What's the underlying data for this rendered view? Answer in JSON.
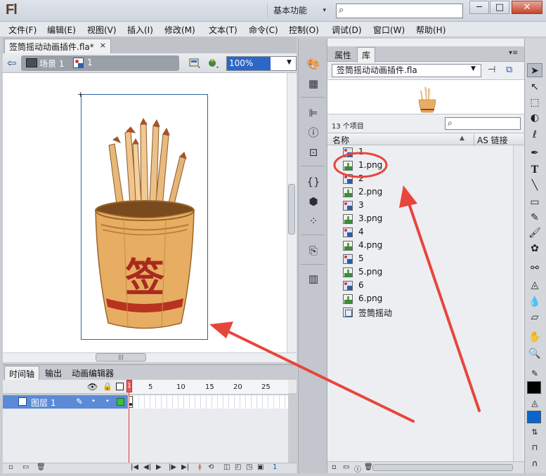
{
  "app": {
    "logo": "Fl",
    "workspace": "基本功能",
    "window_buttons": {
      "minimize": "─",
      "maximize": "□",
      "close": "✕"
    }
  },
  "menu": [
    "文件(F)",
    "编辑(E)",
    "视图(V)",
    "插入(I)",
    "修改(M)",
    "文本(T)",
    "命令(C)",
    "控制(O)",
    "调试(D)",
    "窗口(W)",
    "帮助(H)"
  ],
  "document": {
    "tab": "签筒摇动动画插件.fla*",
    "tab_close": "×",
    "scene": "场景 1",
    "symbol": "1",
    "zoom": "100%"
  },
  "timeline": {
    "tabs": [
      "时间轴",
      "输出",
      "动画编辑器"
    ],
    "ticks": [
      "1",
      "5",
      "10",
      "15",
      "20",
      "25"
    ],
    "playhead": "1",
    "layer": "图层 1",
    "current_frame": "1"
  },
  "library": {
    "tabs": [
      "属性",
      "库"
    ],
    "document": "签筒摇动动画插件.fla",
    "count": "13 个项目",
    "columns": {
      "name": "名称",
      "linkage": "AS 链接"
    },
    "items": [
      {
        "label": "1",
        "type": "bitmap-symbol"
      },
      {
        "label": "1.png",
        "type": "png"
      },
      {
        "label": "2",
        "type": "bitmap-symbol"
      },
      {
        "label": "2.png",
        "type": "png"
      },
      {
        "label": "3",
        "type": "bitmap-symbol"
      },
      {
        "label": "3.png",
        "type": "png"
      },
      {
        "label": "4",
        "type": "bitmap-symbol"
      },
      {
        "label": "4.png",
        "type": "png"
      },
      {
        "label": "5",
        "type": "bitmap-symbol"
      },
      {
        "label": "5.png",
        "type": "png"
      },
      {
        "label": "6",
        "type": "bitmap-symbol"
      },
      {
        "label": "6.png",
        "type": "png"
      },
      {
        "label": "签筒摇动",
        "type": "graphic-symbol"
      }
    ]
  },
  "stage_image": {
    "character": "签"
  },
  "colors": {
    "accent_selection": "#2c66c6",
    "layer_selected": "#5b8ad6",
    "playhead": "#d73b3b",
    "annotation": "#e8453c",
    "fill_color": "#0a66cc",
    "stroke_color": "#000000"
  }
}
